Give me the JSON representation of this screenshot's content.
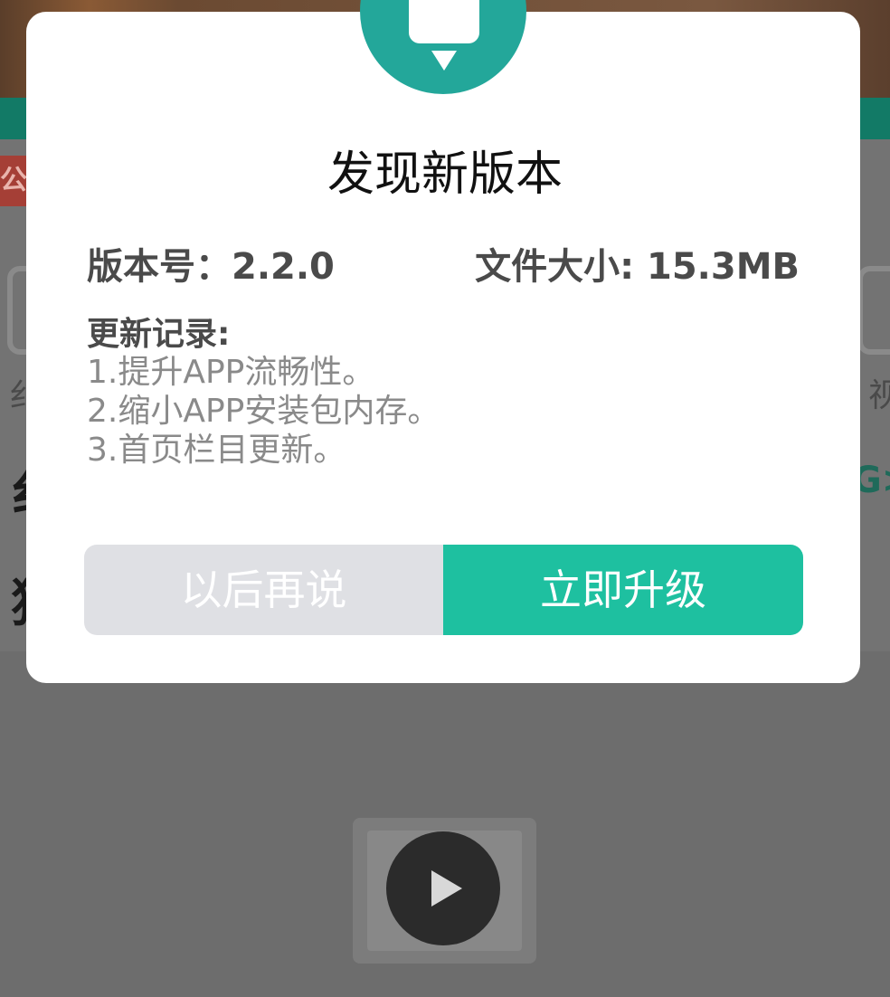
{
  "background": {
    "notice_tag": "公",
    "left_label": "纟",
    "right_label": "视",
    "more_arrow": "G>",
    "row1_text": "纟",
    "row2_text": "狈"
  },
  "dialog": {
    "title": "发现新版本",
    "version_text": "版本号：2.2.0",
    "file_size_text": "文件大小: 15.3MB",
    "changelog_heading": "更新记录:",
    "changelog": [
      "1.提升APP流畅性。",
      "2.缩小APP安装包内存。",
      "3.首页栏目更新。"
    ],
    "later_button": "以后再说",
    "upgrade_button": "立即升级"
  },
  "colors": {
    "accent": "#1ec0a0",
    "rocket_circle": "#23a79a",
    "overlay": "#6b6b6b",
    "secondary_button": "#dfe0e4"
  },
  "icons": {
    "rocket": "rocket-icon",
    "play": "play-icon"
  }
}
